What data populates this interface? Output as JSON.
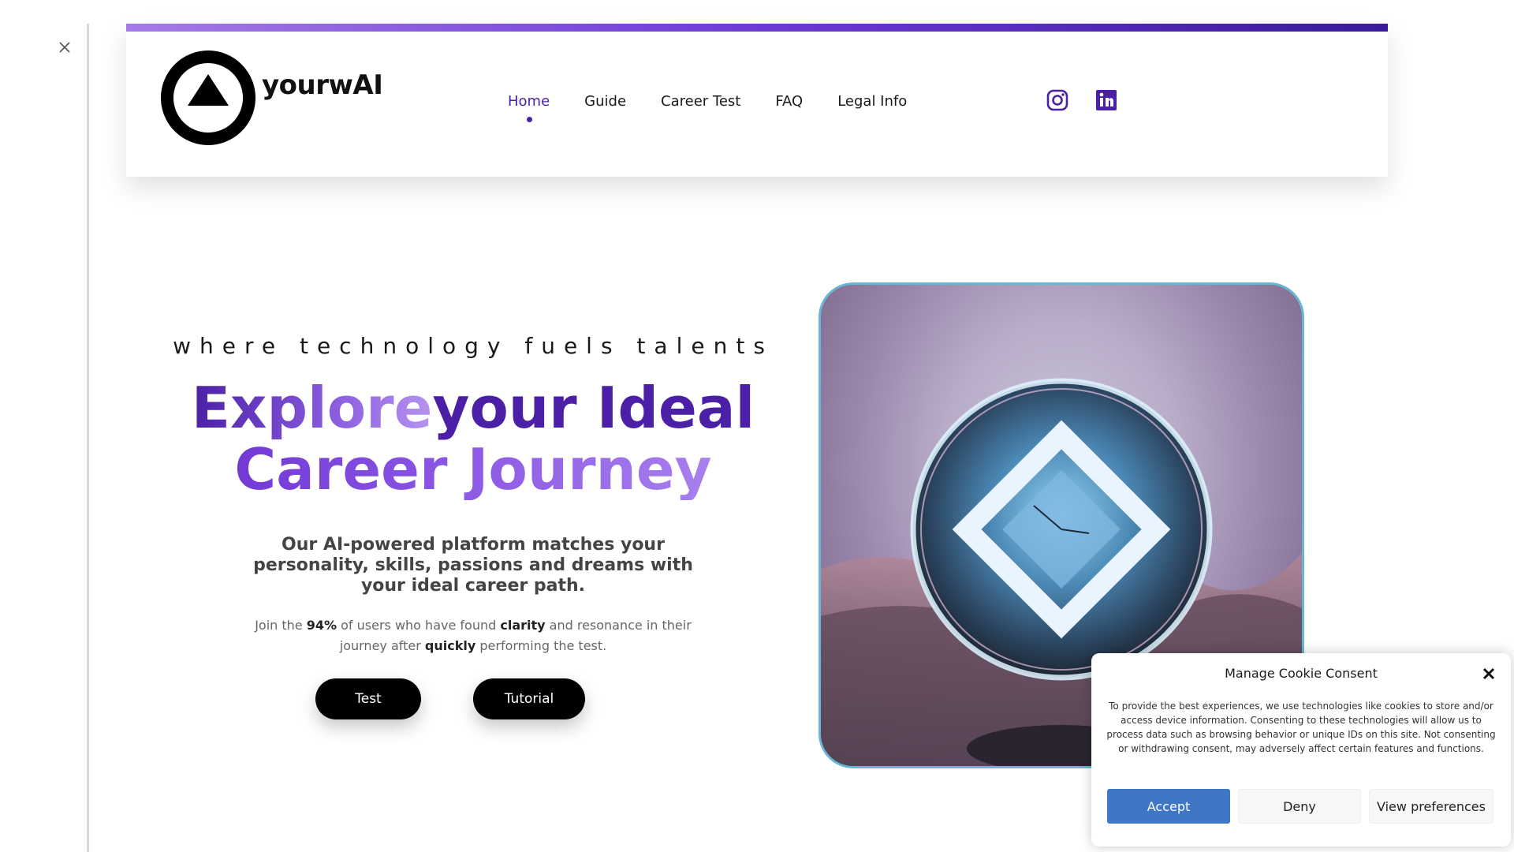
{
  "header": {
    "brand": "yourwAI",
    "nav": [
      {
        "label": "Home",
        "active": true
      },
      {
        "label": "Guide",
        "active": false
      },
      {
        "label": "Career Test",
        "active": false
      },
      {
        "label": "FAQ",
        "active": false
      },
      {
        "label": "Legal Info",
        "active": false
      }
    ],
    "social_icons": [
      "instagram-icon",
      "linkedin-icon"
    ],
    "accent_color": "#4b1fa6"
  },
  "hero": {
    "tagline": "where technology fuels talents",
    "headline_word1": "Explore",
    "headline_word2": "your Ideal",
    "headline_line2": "Career Journey",
    "subhead": "Our AI-powered platform matches your personality, skills, passions and dreams with your ideal career path.",
    "body_pre": "Join the ",
    "body_stat": "94%",
    "body_mid1": " of users who have found ",
    "body_b1": "clarity",
    "body_mid2": " and resonance in their journey after ",
    "body_b2": "quickly",
    "body_post": " performing the test.",
    "buttons": {
      "test": "Test",
      "tutorial": "Tutorial"
    }
  },
  "cookie": {
    "title": "Manage Cookie Consent",
    "text": "To provide the best experiences, we use technologies like cookies to store and/or access device information. Consenting to these technologies will allow us to process data such as browsing behavior or unique IDs on this site. Not consenting or withdrawing consent, may adversely affect certain features and functions.",
    "accept": "Accept",
    "deny": "Deny",
    "preferences": "View preferences",
    "accept_color": "#3f76c5"
  }
}
